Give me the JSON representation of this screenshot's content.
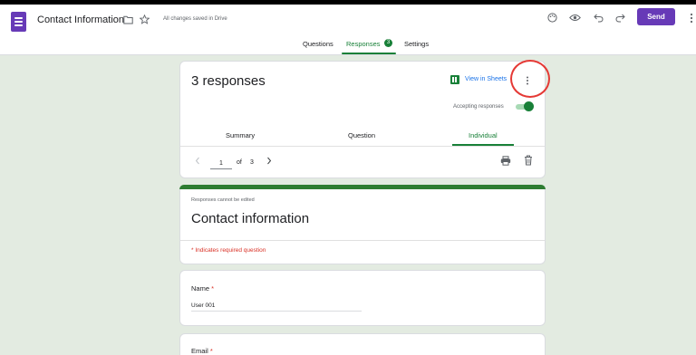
{
  "header": {
    "doc_title": "Contact Information",
    "save_status": "All changes saved in Drive",
    "send_label": "Send",
    "icons": [
      "forms-logo-icon",
      "folder-icon",
      "star-icon",
      "palette-icon",
      "eye-icon",
      "undo-icon",
      "redo-icon",
      "more-vert-icon"
    ]
  },
  "tabs": {
    "questions": "Questions",
    "responses": "Responses",
    "responses_count": "3",
    "settings": "Settings"
  },
  "responses_card": {
    "title": "3 responses",
    "view_in_sheets": "View in Sheets",
    "accepting_label": "Accepting responses",
    "accepting": true,
    "subtabs": {
      "summary": "Summary",
      "question": "Question",
      "individual": "Individual"
    },
    "pagination": {
      "current": "1",
      "of": "of",
      "total": "3"
    }
  },
  "form": {
    "note": "Responses cannot be edited",
    "title": "Contact information",
    "required_note": "* Indicates required question"
  },
  "questions": [
    {
      "label": "Name",
      "required_mark": "*",
      "answer": "User 001"
    },
    {
      "label": "Email",
      "required_mark": "*"
    }
  ],
  "colors": {
    "brand": "#673ab7",
    "accent_green": "#188038",
    "background": "#e3ebe1",
    "required_red": "#d93025",
    "link_blue": "#1a73e8",
    "highlight_circle": "#e53935"
  }
}
